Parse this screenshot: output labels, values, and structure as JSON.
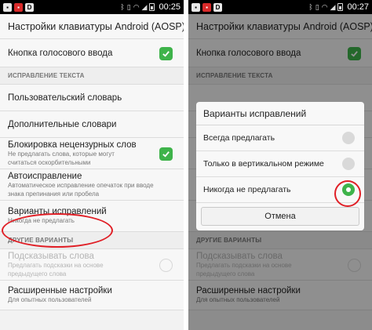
{
  "left": {
    "status": {
      "time": "00:25"
    },
    "title": "Настройки клавиатуры Android (AOSP)",
    "voice_key": {
      "title": "Кнопка голосового ввода",
      "checked": true
    },
    "section_text": "ИСПРАВЛЕНИЕ ТЕКСТА",
    "user_dict": {
      "title": "Пользовательский словарь"
    },
    "extra_dicts": {
      "title": "Дополнительные словари"
    },
    "block_offensive": {
      "title": "Блокировка нецензурных слов",
      "summary1": "Не предлагать слова, которые могут",
      "summary2": "считаться оскорбительными",
      "checked": true
    },
    "autocorrect": {
      "title": "Автоисправление",
      "summary1": "Автоматическое исправление опечаток при вводе",
      "summary2": "знака препинания или пробела"
    },
    "suggestions": {
      "title": "Варианты исправлений",
      "summary": "Никогда не предлагать"
    },
    "section_other": "ДРУГИЕ ВАРИАНТЫ",
    "hint_words": {
      "title": "Подсказывать слова",
      "summary1": "Предлагать подсказки на основе",
      "summary2": "предыдущего слова",
      "checked": false
    },
    "advanced": {
      "title": "Расширенные настройки",
      "summary": "Для опытных пользователей"
    }
  },
  "right": {
    "status": {
      "time": "00:27"
    },
    "title": "Настройки клавиатуры Android (AOSP)",
    "voice_key": {
      "title": "Кнопка голосового ввода"
    },
    "section_text": "ИСПРАВЛЕНИЕ ТЕКСТА",
    "section_other": "ДРУГИЕ ВАРИАНТЫ",
    "hint_words": {
      "title": "Подсказывать слова",
      "summary1": "Предлагать подсказки на основе",
      "summary2": "предыдущего слова"
    },
    "advanced": {
      "title": "Расширенные настройки",
      "summary": "Для опытных пользователей"
    },
    "dialog": {
      "title": "Варианты исправлений",
      "options": [
        {
          "label": "Всегда предлагать",
          "selected": false
        },
        {
          "label": "Только в вертикальном режиме",
          "selected": false
        },
        {
          "label": "Никогда не предлагать",
          "selected": true
        }
      ],
      "cancel": "Отмена"
    }
  },
  "colors": {
    "accent": "#3eb34a",
    "annotation": "#e01f26"
  },
  "icons": [
    "bluetooth-icon",
    "vibrate-icon",
    "wifi-icon",
    "signal-icon",
    "battery-icon",
    "check-icon"
  ]
}
